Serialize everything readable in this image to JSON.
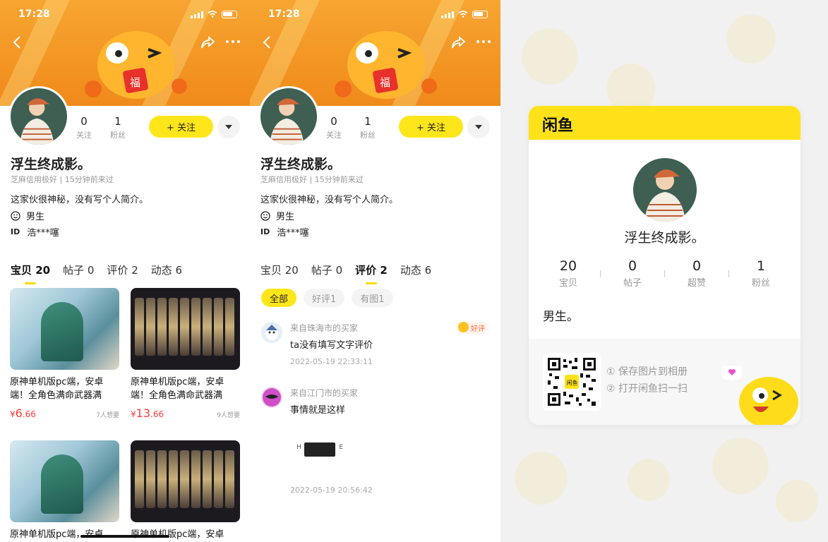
{
  "status": {
    "time": "17:28"
  },
  "profile": {
    "name": "浮生终成影。",
    "credit": "芝麻信用极好 | 15分钟前来过",
    "bio": "这家伙很神秘，没有写个人简介。",
    "gender": "男生",
    "id_label": "ID",
    "id_value": "浩***噻",
    "follow_count": "0",
    "follow_label": "关注",
    "fans_count": "1",
    "fans_label": "粉丝",
    "follow_button": "+ 关注"
  },
  "tabs": [
    "宝贝 20",
    "帖子 0",
    "评价 2",
    "动态 6"
  ],
  "items": [
    {
      "title": "原神单机版pc端，安卓端！全角色满命武器满",
      "currency": "¥",
      "price_int": "6",
      "price_dec": ".66",
      "want": "7人想要"
    },
    {
      "title": "原神单机版pc端，安卓端！全角色满命武器满",
      "currency": "¥",
      "price_int": "13",
      "price_dec": ".66",
      "want": "9人想要"
    },
    {
      "title": "原神单机版pc端，安卓",
      "currency": "",
      "price_int": "",
      "price_dec": "",
      "want": ""
    },
    {
      "title": "原神单机版pc端，安卓",
      "currency": "",
      "price_int": "",
      "price_dec": "",
      "want": ""
    }
  ],
  "review_filters": [
    "全部",
    "好评1",
    "有图1"
  ],
  "reviews": [
    {
      "from": "来自珠海市的买家",
      "text": "ta没有填写文字评价",
      "date": "2022-05-19 22:33:11",
      "badge": "好评"
    },
    {
      "from": "来自江门市的买家",
      "text": "事情就是这样",
      "date": "2022-05-19 20:56:42",
      "badge": "",
      "img_left": "H",
      "img_right": "E"
    }
  ],
  "share_card": {
    "logo": "闲鱼",
    "name": "浮生终成影。",
    "stats": [
      {
        "n": "20",
        "l": "宝贝"
      },
      {
        "n": "0",
        "l": "帖子"
      },
      {
        "n": "0",
        "l": "超赞"
      },
      {
        "n": "1",
        "l": "粉丝"
      }
    ],
    "gender": "男生。",
    "hint1": "① 保存图片到相册",
    "hint2": "② 打开闲鱼扫一扫",
    "qr_center": "闲鱼"
  },
  "colors": {
    "accent": "#ffe61a",
    "price": "#ff3b3b",
    "banner": "#f29520"
  }
}
